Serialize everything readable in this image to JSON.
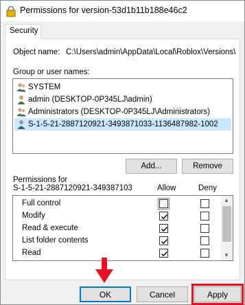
{
  "window": {
    "title": "Permissions for version-53d1b11b188e46c2"
  },
  "tabs": [
    {
      "label": "Security"
    }
  ],
  "object": {
    "label": "Object name:",
    "value": "C:\\Users\\admin\\AppData\\Local\\Roblox\\Versions\\"
  },
  "group_label": "Group or user names:",
  "users": [
    {
      "name": "SYSTEM",
      "icon": "user-group-icon"
    },
    {
      "name": "admin (DESKTOP-0P345LJ\\admin)",
      "icon": "user-icon"
    },
    {
      "name": "Administrators (DESKTOP-0P345LJ\\Administrators)",
      "icon": "user-group-icon"
    },
    {
      "name": "S-1-5-21-2887120921-3493871033-1136487982-1002",
      "icon": "user-icon"
    }
  ],
  "buttons": {
    "add": "Add...",
    "remove": "Remove",
    "ok": "OK",
    "cancel": "Cancel",
    "apply": "Apply"
  },
  "permissions": {
    "label_line1": "Permissions for",
    "label_line2": "S-1-5-21-2887120921-349387103",
    "allow_header": "Allow",
    "deny_header": "Deny",
    "rows": [
      {
        "name": "Full control",
        "allow": false,
        "deny": false
      },
      {
        "name": "Modify",
        "allow": true,
        "deny": false
      },
      {
        "name": "Read & execute",
        "allow": true,
        "deny": false
      },
      {
        "name": "List folder contents",
        "allow": true,
        "deny": false
      },
      {
        "name": "Read",
        "allow": true,
        "deny": false
      }
    ]
  },
  "colors": {
    "selection": "#cce8ff",
    "highlight": "#e81123",
    "ok_border": "#0078d7"
  }
}
